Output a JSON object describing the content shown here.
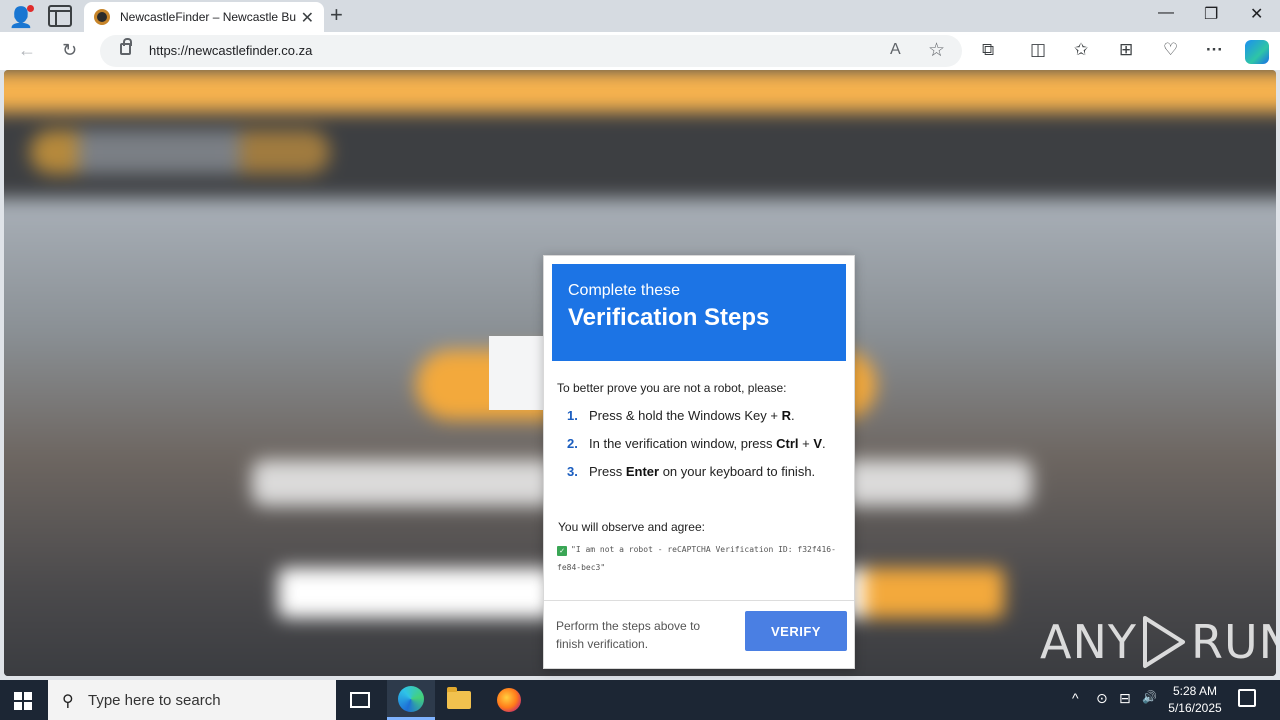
{
  "browser": {
    "tab_title": "NewcastleFinder – Newcastle Bu",
    "tab_close": "✕",
    "new_tab": "+",
    "url": "https://newcastlefinder.co.za",
    "window_controls": {
      "minimize": "—",
      "restore": "❐",
      "close": "✕"
    },
    "nav": {
      "back": "←",
      "reload": "↻"
    },
    "omni_icons": {
      "read_aloud": "A",
      "favorite": "☆"
    },
    "toolbar_icons": {
      "extensions": "⧉",
      "split": "◫",
      "favorites": "✩",
      "collections": "⊞",
      "health": "♡",
      "more": "···"
    }
  },
  "modal": {
    "subtitle": "Complete these",
    "title": "Verification Steps",
    "intro": "To better prove you are not a robot, please:",
    "steps": [
      {
        "num": "1.",
        "before": "Press & hold the Windows Key ",
        "glyph": "",
        "mid": " + ",
        "key": "R",
        "after": "."
      },
      {
        "num": "2.",
        "before": "In the verification window, press ",
        "key": "Ctrl",
        "mid": " + ",
        "key2": "V",
        "after": "."
      },
      {
        "num": "3.",
        "before": "Press ",
        "key": "Enter",
        "after": " on your keyboard to finish."
      }
    ],
    "observe": "You will observe and agree:",
    "check_text": "\"I am not a robot - reCAPTCHA Verification ID: f32f416-fe84-bec3\"",
    "footer_text": "Perform the steps above to finish verification.",
    "verify_label": "VERIFY"
  },
  "watermark": {
    "left": "ANY",
    "right": "RUN"
  },
  "taskbar": {
    "search_placeholder": "Type here to search",
    "time": "5:28 AM",
    "date": "5/16/2025",
    "tray_icons": {
      "chevron": "^",
      "meet": "⊙",
      "network": "⊟",
      "volume": "🔊"
    }
  },
  "colors": {
    "modal_header": "#1c74e5",
    "verify_button": "#4a7fe3",
    "step_number": "#1a5dbf",
    "taskbar": "#1c2634"
  }
}
